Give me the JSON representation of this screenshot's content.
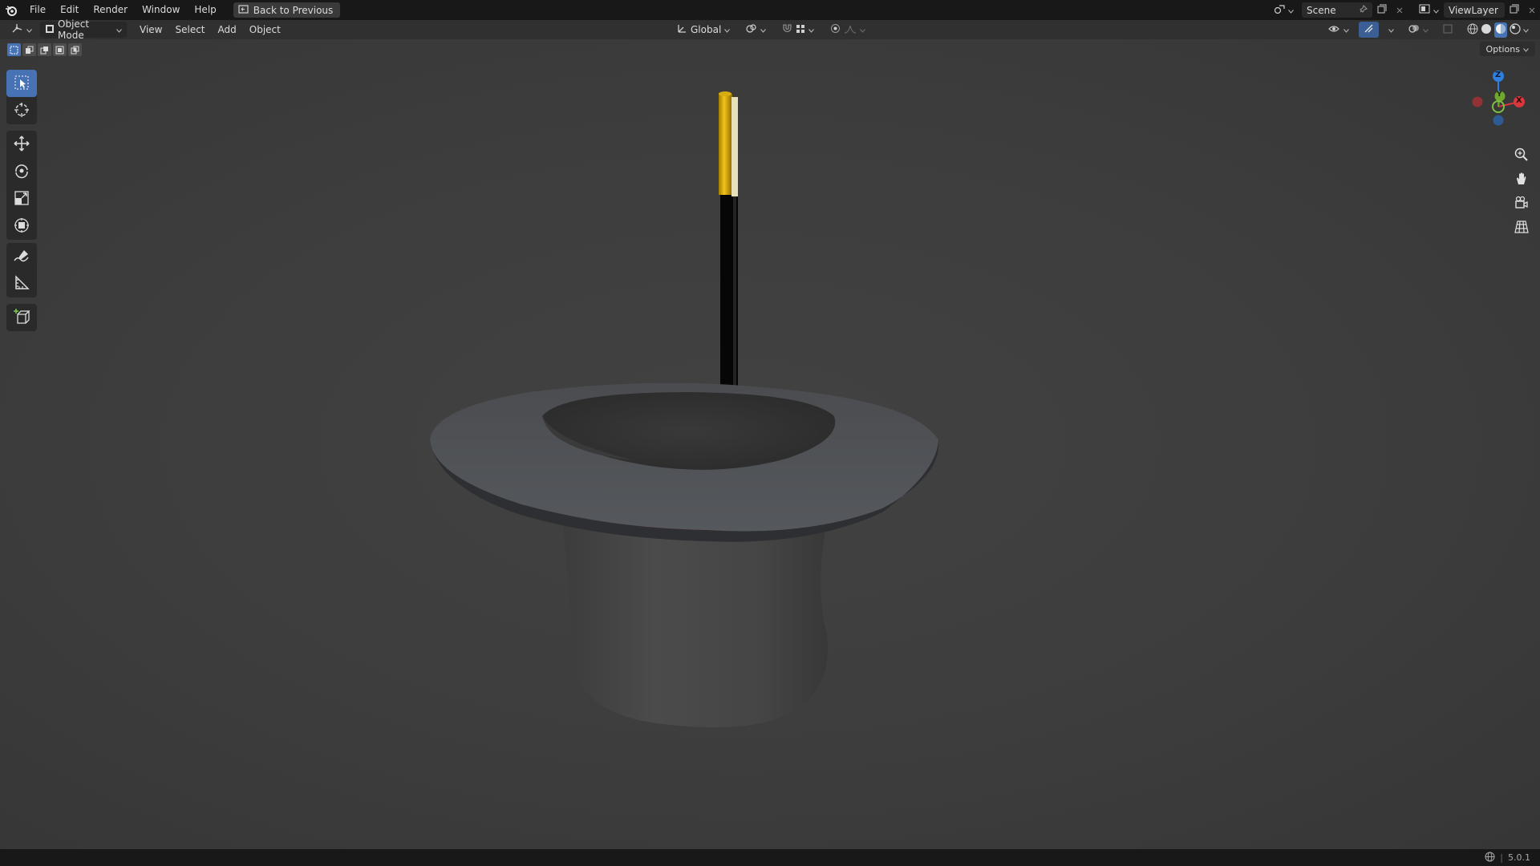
{
  "topbar": {
    "menu": [
      "File",
      "Edit",
      "Render",
      "Window",
      "Help"
    ],
    "back_label": "Back to Previous",
    "scene_name": "Scene",
    "viewlayer_name": "ViewLayer"
  },
  "header": {
    "mode_label": "Object Mode",
    "menus": [
      "View",
      "Select",
      "Add",
      "Object"
    ],
    "transform_orientation": "Global"
  },
  "viewport": {
    "options_label": "Options",
    "gizmo_axes": {
      "x": "X",
      "y": "Y",
      "z": "Z"
    },
    "colors": {
      "x_axis": "#d8383d",
      "y_axis": "#6fa82c",
      "z_axis": "#2f7fe2",
      "active_tool": "#4772b3"
    }
  },
  "tools": [
    {
      "name": "select-box-icon"
    },
    {
      "name": "cursor-icon"
    },
    {
      "name": "move-icon"
    },
    {
      "name": "rotate-icon"
    },
    {
      "name": "scale-icon"
    },
    {
      "name": "transform-icon"
    },
    {
      "name": "annotate-icon"
    },
    {
      "name": "measure-icon"
    },
    {
      "name": "add-cube-icon"
    }
  ],
  "statusbar": {
    "version": "5.0.1"
  }
}
